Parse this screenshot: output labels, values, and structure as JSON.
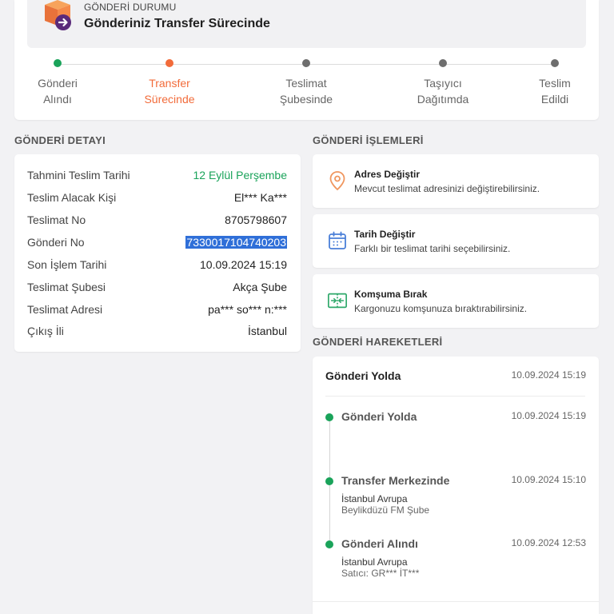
{
  "status": {
    "label": "GÖNDERİ DURUMU",
    "title": "Gönderiniz Transfer Sürecinde"
  },
  "steps": [
    {
      "line1": "Gönderi",
      "line2": "Alındı",
      "state": "done"
    },
    {
      "line1": "Transfer",
      "line2": "Sürecinde",
      "state": "current"
    },
    {
      "line1": "Teslimat",
      "line2": "Şubesinde",
      "state": "pending"
    },
    {
      "line1": "Taşıyıcı",
      "line2": "Dağıtımda",
      "state": "pending"
    },
    {
      "line1": "Teslim",
      "line2": "Edildi",
      "state": "pending"
    }
  ],
  "detail": {
    "title": "GÖNDERİ DETAYI",
    "rows": [
      {
        "key": "Tahmini Teslim Tarihi",
        "value": "12 Eylül Perşembe"
      },
      {
        "key": "Teslim Alacak Kişi",
        "value": "El*** Ka***"
      },
      {
        "key": "Teslimat No",
        "value": "8705798607"
      },
      {
        "key": "Gönderi No",
        "value": "7330017104740203"
      },
      {
        "key": "Son İşlem Tarihi",
        "value": "10.09.2024 15:19"
      },
      {
        "key": "Teslimat Şubesi",
        "value": "Akça Şube"
      },
      {
        "key": "Teslimat Adresi",
        "value": "pa*** so*** n:***"
      },
      {
        "key": "Çıkış İli",
        "value": "İstanbul"
      }
    ]
  },
  "operations": {
    "title": "GÖNDERİ İŞLEMLERİ",
    "items": [
      {
        "title": "Adres Değiştir",
        "desc": "Mevcut teslimat adresinizi değiştirebilirsiniz.",
        "icon": "location-pin-icon"
      },
      {
        "title": "Tarih Değiştir",
        "desc": "Farklı bir teslimat tarihi seçebilirsiniz.",
        "icon": "calendar-icon"
      },
      {
        "title": "Komşuma Bırak",
        "desc": "Kargonuzu komşunuza bıraktırabilirsiniz.",
        "icon": "handover-icon"
      }
    ]
  },
  "movements": {
    "title": "GÖNDERİ HAREKETLERİ",
    "current": {
      "label": "Gönderi Yolda",
      "time": "10.09.2024 15:19"
    },
    "events": [
      {
        "title": "Gönderi Yolda",
        "time": "10.09.2024 15:19",
        "line1": "",
        "line2": ""
      },
      {
        "title": "Transfer Merkezinde",
        "time": "10.09.2024 15:10",
        "line1": "İstanbul Avrupa",
        "line2": "Beylikdüzü FM Şube"
      },
      {
        "title": "Gönderi Alındı",
        "time": "10.09.2024 12:53",
        "line1": "İstanbul Avrupa",
        "line2": "Satıcı: GR*** İT***"
      }
    ]
  },
  "colors": {
    "green": "#1aa35a",
    "orange": "#f26b3a",
    "selection": "#2f6fd8"
  }
}
